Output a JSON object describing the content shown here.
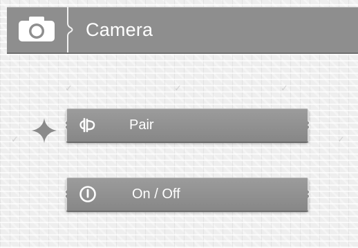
{
  "header": {
    "icon": "camera-icon",
    "title": "Camera"
  },
  "menu": {
    "items": [
      {
        "id": "pair",
        "icon": "pair-icon",
        "label": "Pair",
        "selected": true
      },
      {
        "id": "power",
        "icon": "power-icon",
        "label": "On / Off",
        "selected": false
      }
    ]
  },
  "colors": {
    "bar": "#8e8e8e",
    "button": "#919191",
    "text": "#ffffff",
    "background": "#eeeeee"
  }
}
